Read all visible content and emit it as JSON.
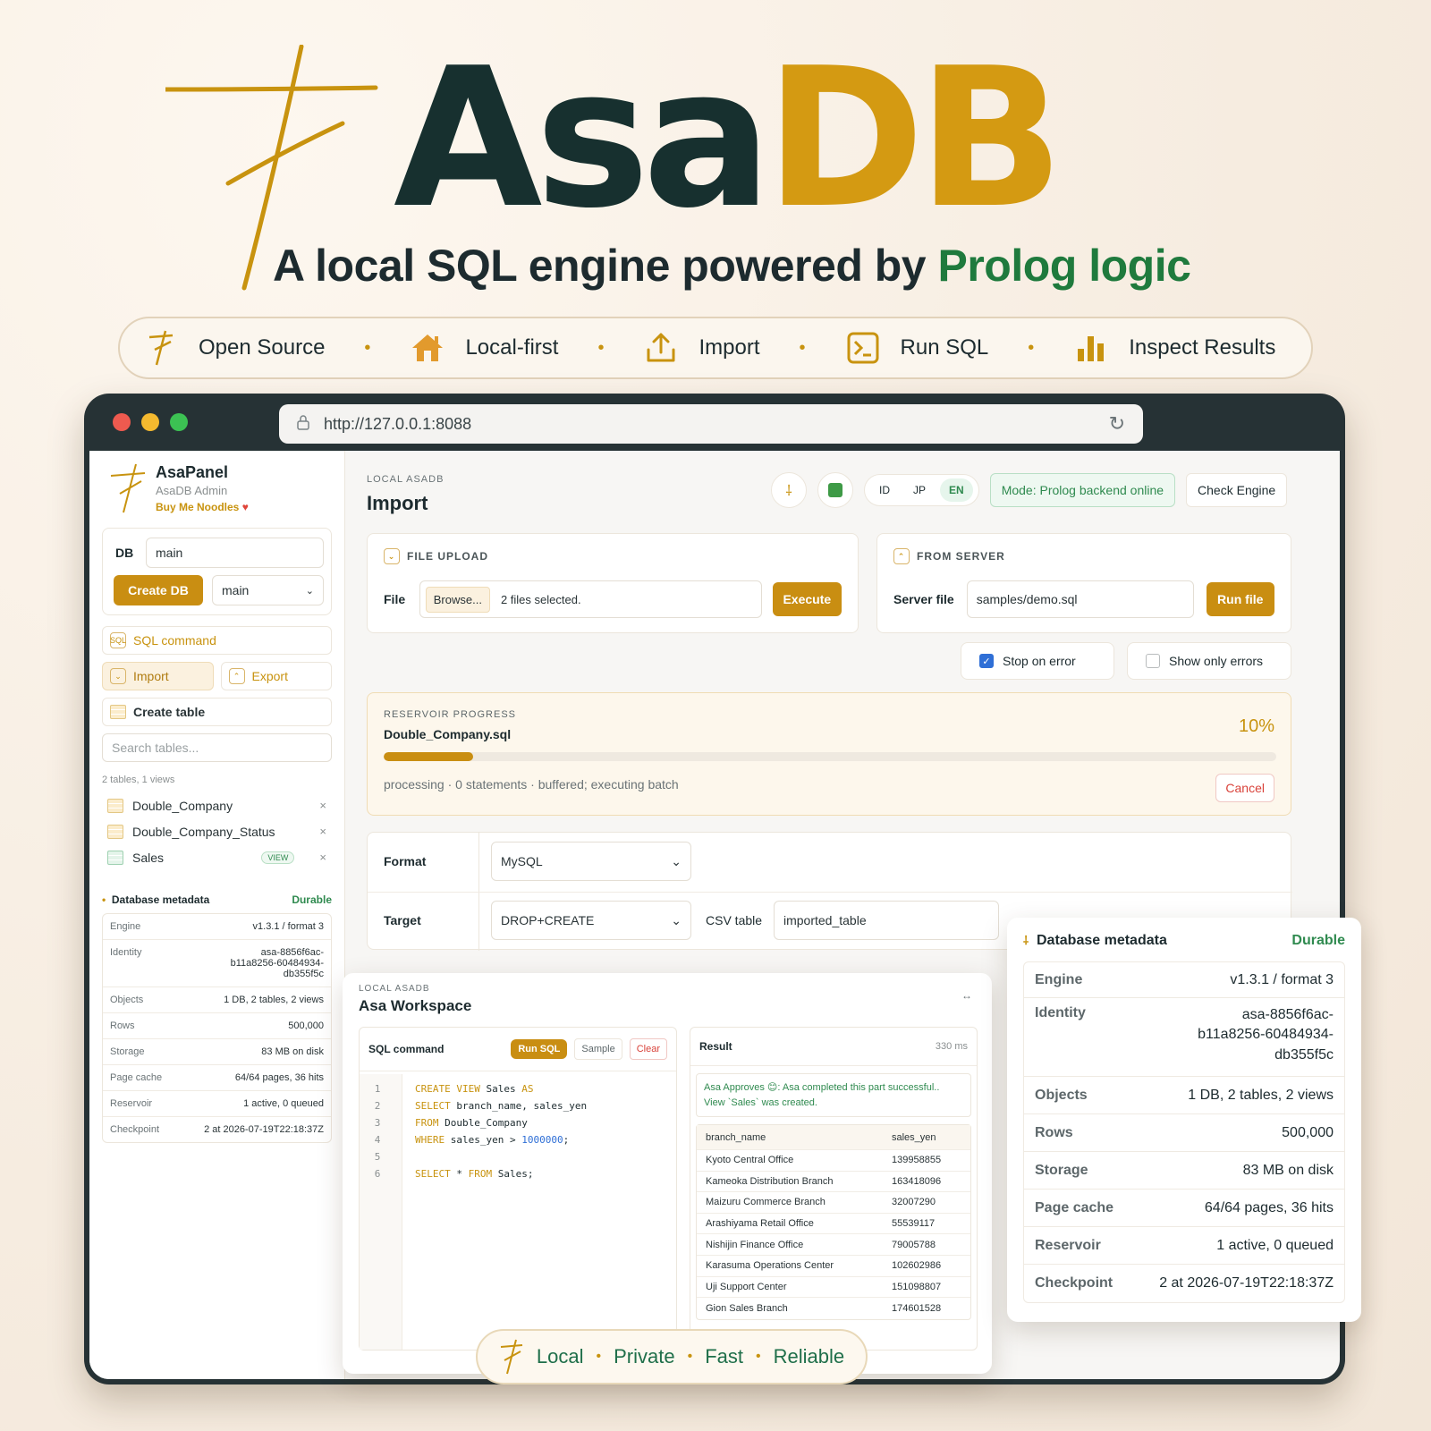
{
  "hero": {
    "title_part1": "Asa",
    "title_part2": "DB",
    "tagline_main": "A local SQL engine powered by ",
    "tagline_highlight": "Prolog logic",
    "features": [
      "Open Source",
      "Local-first",
      "Import",
      "Run SQL",
      "Inspect Results"
    ]
  },
  "browser": {
    "url": "http://127.0.0.1:8088"
  },
  "sidebar": {
    "app_name": "AsaPanel",
    "app_sub": "AsaDB Admin",
    "support_link": "Buy Me Noodles",
    "db_label": "DB",
    "db_input": "main",
    "create_db": "Create DB",
    "db_select": "main",
    "nav": {
      "sql_command": "SQL command",
      "import": "Import",
      "export": "Export",
      "create_table": "Create table"
    },
    "search_placeholder": "Search tables...",
    "summary": "2 tables, 1 views",
    "tables": [
      {
        "name": "Double_Company"
      },
      {
        "name": "Double_Company_Status"
      },
      {
        "name": "Sales",
        "badge": "VIEW"
      }
    ],
    "meta_title": "Database metadata",
    "meta_status": "Durable"
  },
  "metadata": [
    {
      "k": "Engine",
      "v": "v1.3.1 / format 3"
    },
    {
      "k": "Identity",
      "v": "asa-8856f6ac-\nb11a8256-60484934-\ndb355f5c"
    },
    {
      "k": "Objects",
      "v": "1 DB, 2 tables, 2 views"
    },
    {
      "k": "Rows",
      "v": "500,000"
    },
    {
      "k": "Storage",
      "v": "83 MB on disk"
    },
    {
      "k": "Page cache",
      "v": "64/64 pages, 36 hits"
    },
    {
      "k": "Reservoir",
      "v": "1 active, 0 queued"
    },
    {
      "k": "Checkpoint",
      "v": "2 at 2026-07-19T22:18:37Z"
    }
  ],
  "main": {
    "kicker": "LOCAL ASADB",
    "title": "Import",
    "lang": [
      "ID",
      "JP",
      "EN"
    ],
    "lang_active": "EN",
    "mode": "Mode: Prolog backend online",
    "check_engine": "Check Engine",
    "file_upload": {
      "title": "FILE UPLOAD",
      "label": "File",
      "browse": "Browse...",
      "status": "2 files selected.",
      "execute": "Execute"
    },
    "from_server": {
      "title": "FROM SERVER",
      "label": "Server file",
      "value": "samples/demo.sql",
      "run": "Run file"
    },
    "stop_on_error": "Stop on error",
    "show_only_errors": "Show only errors",
    "progress": {
      "title": "RESERVOIR PROGRESS",
      "file": "Double_Company.sql",
      "percent_label": "10%",
      "fraction": 0.1,
      "status": "processing · 0 statements · buffered; executing batch",
      "cancel": "Cancel"
    },
    "format_label": "Format",
    "format_value": "MySQL",
    "target_label": "Target",
    "target_value": "DROP+CREATE",
    "csv_label": "CSV table",
    "csv_value": "imported_table"
  },
  "workspace": {
    "kicker": "LOCAL ASADB",
    "title": "Asa Workspace",
    "sql_label": "SQL command",
    "run_sql": "Run SQL",
    "sample": "Sample",
    "clear": "Clear",
    "result_label": "Result",
    "time": "330 ms",
    "message_line1": "Asa Approves 😊: Asa completed this part successful..",
    "message_line2": "View `Sales` was created.",
    "code_lines": [
      {
        "n": "1",
        "kw": "CREATE VIEW",
        "txt": " Sales ",
        "kw2": "AS"
      },
      {
        "n": "2",
        "kw": "SELECT",
        "txt": " branch_name, sales_yen",
        "kw2": ""
      },
      {
        "n": "3",
        "kw": "FROM",
        "txt": " Double_Company",
        "kw2": ""
      },
      {
        "n": "4",
        "kw": "WHERE",
        "txt": " sales_yen > ",
        "num": "1000000",
        "tail": ";"
      },
      {
        "n": "5",
        "kw": "",
        "txt": "",
        "kw2": ""
      },
      {
        "n": "6",
        "kw": "SELECT",
        "txt": " * ",
        "kw2": "FROM",
        "tail": " Sales;"
      }
    ],
    "columns": [
      "branch_name",
      "sales_yen"
    ],
    "rows": [
      [
        "Kyoto Central Office",
        "139958855"
      ],
      [
        "Kameoka Distribution Branch",
        "163418096"
      ],
      [
        "Maizuru Commerce Branch",
        "32007290"
      ],
      [
        "Arashiyama Retail Office",
        "55539117"
      ],
      [
        "Nishijin Finance Office",
        "79005788"
      ],
      [
        "Karasuma Operations Center",
        "102602986"
      ],
      [
        "Uji Support Center",
        "151098807"
      ],
      [
        "Gion Sales Branch",
        "174601528"
      ]
    ]
  },
  "bottom_pill": [
    "Local",
    "Private",
    "Fast",
    "Reliable"
  ],
  "colors": {
    "gold": "#c8930f",
    "dark": "#17302f",
    "green": "#1f7a3d"
  }
}
